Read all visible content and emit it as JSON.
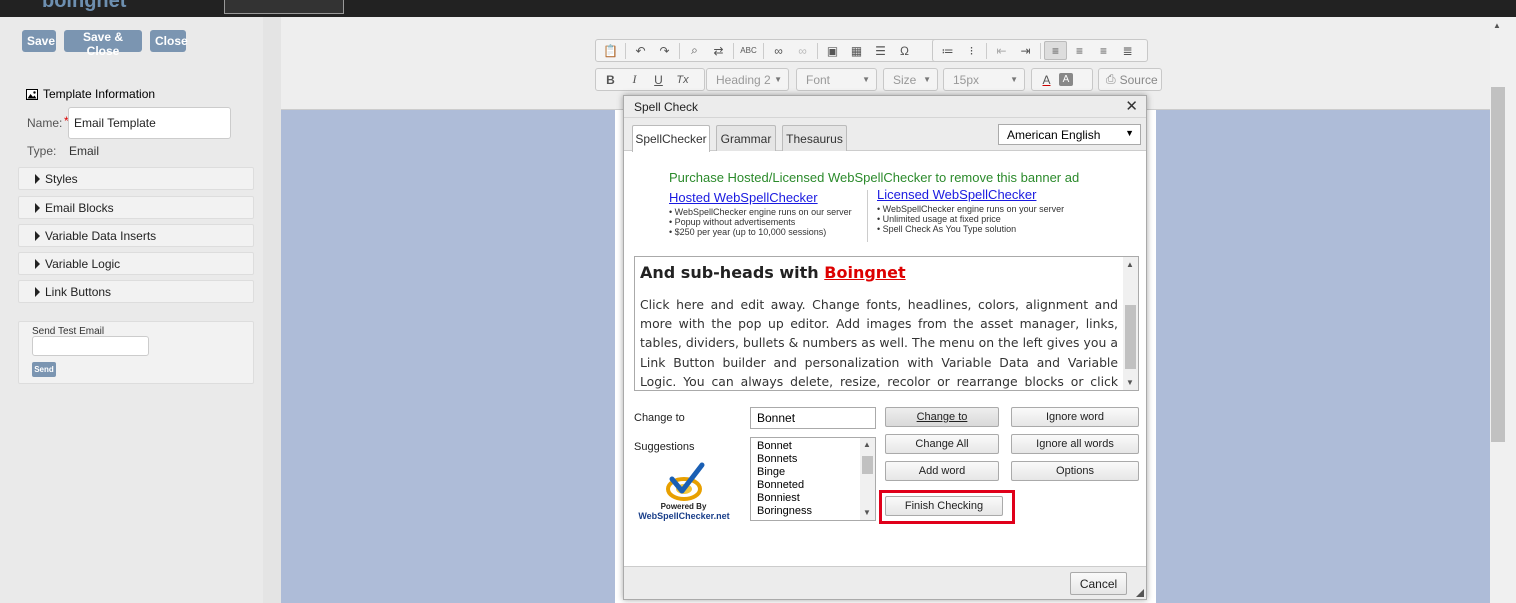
{
  "topbar": {
    "logo_text": "boingnet"
  },
  "sidebar": {
    "buttons": {
      "save": "Save",
      "save_close": "Save & Close",
      "close": "Close"
    },
    "template_info": {
      "heading": "Template Information",
      "name_label": "Name:",
      "name_required": "*",
      "name_value": "Email Template",
      "type_label": "Type:",
      "type_value": "Email"
    },
    "sections": [
      "Styles",
      "Email Blocks",
      "Variable Data Inserts",
      "Variable Logic",
      "Link Buttons"
    ],
    "test_email": {
      "label": "Send Test Email",
      "value": "",
      "send": "Send"
    }
  },
  "toolbar": {
    "format": "Heading 2",
    "font": "Font",
    "size": "Size",
    "line_height": "15px",
    "source": "Source",
    "bold": "B",
    "italic": "I",
    "underline": "U",
    "remove_format": "Tx",
    "text_color": "A",
    "bg_color": "A",
    "omega": "Ω"
  },
  "dialog": {
    "title": "Spell Check",
    "tabs": [
      "SpellChecker",
      "Grammar",
      "Thesaurus"
    ],
    "active_tab": "SpellChecker",
    "language": "American English",
    "banner": {
      "headline": "Purchase Hosted/Licensed WebSpellChecker to remove this banner ad",
      "hosted": {
        "title": "Hosted WebSpellChecker",
        "lines": [
          "• WebSpellChecker engine runs on our server",
          "• Popup without advertisements",
          "• $250 per year (up to 10,000 sessions)"
        ]
      },
      "licensed": {
        "title": "Licensed WebSpellChecker",
        "lines": [
          "• WebSpellChecker engine runs on your server",
          "• Unlimited usage at fixed price",
          "• Spell Check As You Type solution"
        ]
      }
    },
    "preview": {
      "heading_prefix": "And sub-heads with ",
      "misspelled": "Boingnet",
      "paragraph": "Click here and edit away. Change fonts, headlines, colors, alignment and more with the pop up editor. Add images from the asset manager, links, tables, dividers, bullets & numbers as well. The menu on the left gives you a Link Button builder and personalization with Variable Data and Variable Logic. You can always delete, resize, recolor or rearrange blocks or click 'Source' to edit HTML as needed."
    },
    "change_to_label": "Change to",
    "change_to_value": "Bonnet",
    "suggestions_label": "Suggestions",
    "suggestions": [
      "Bonnet",
      "Bonnets",
      "Binge",
      "Bonneted",
      "Bonniest",
      "Boringness"
    ],
    "buttons": {
      "change_to": "Change to",
      "ignore_word": "Ignore word",
      "change_all": "Change All",
      "ignore_all": "Ignore all words",
      "add_word": "Add word",
      "options": "Options",
      "finish": "Finish Checking",
      "cancel": "Cancel"
    },
    "powered": {
      "line1": "Powered By",
      "line2": "WebSpellChecker.net"
    }
  },
  "colors": {
    "accent_button": "#7b95b1",
    "highlight": "#e0001a",
    "banner_green": "#2b8a2b",
    "link_blue": "#1a1ae0",
    "canvas": "#aebcd8"
  }
}
